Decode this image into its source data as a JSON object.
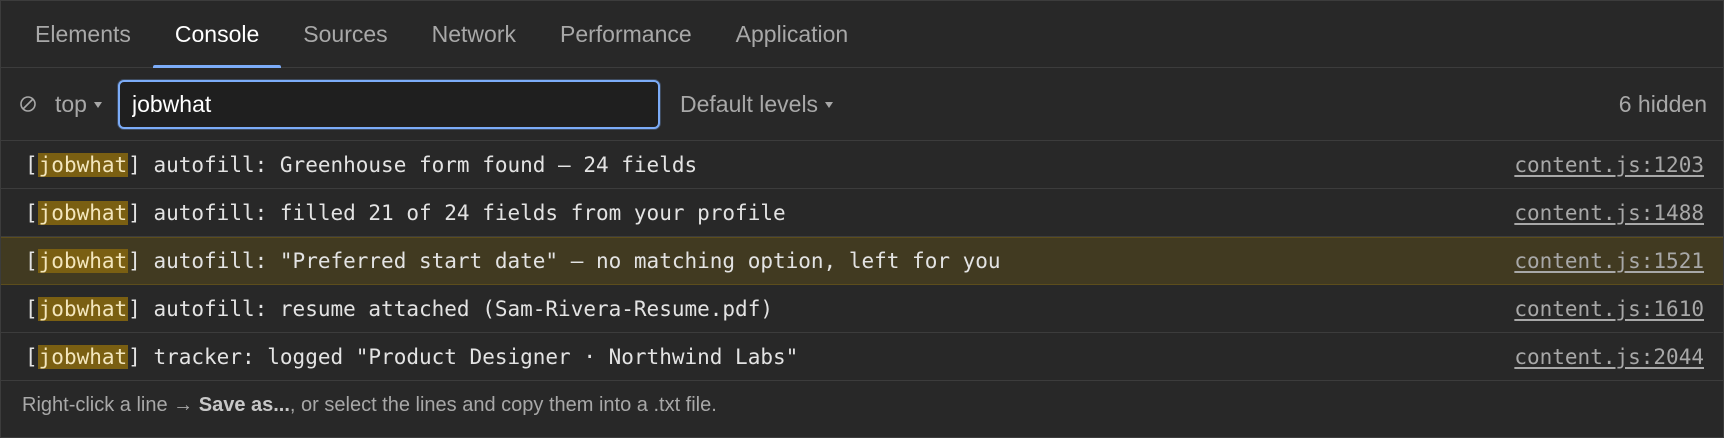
{
  "tabs": [
    {
      "label": "Elements",
      "active": false
    },
    {
      "label": "Console",
      "active": true
    },
    {
      "label": "Sources",
      "active": false
    },
    {
      "label": "Network",
      "active": false
    },
    {
      "label": "Performance",
      "active": false
    },
    {
      "label": "Application",
      "active": false
    }
  ],
  "toolbar": {
    "context_label": "top",
    "filter_value": "jobwhat",
    "levels_label": "Default levels",
    "hidden_count": "6 hidden"
  },
  "logs": [
    {
      "open": "[",
      "tag": "jobwhat",
      "close": "]",
      "text": " autofill: Greenhouse form found — 24 fields",
      "source": "content.js:1203",
      "level": "info"
    },
    {
      "open": "[",
      "tag": "jobwhat",
      "close": "]",
      "text": " autofill: filled 21 of 24 fields from your profile",
      "source": "content.js:1488",
      "level": "info"
    },
    {
      "open": "[",
      "tag": "jobwhat",
      "close": "]",
      "text": " autofill: \"Preferred start date\" — no matching option, left for you",
      "source": "content.js:1521",
      "level": "warn"
    },
    {
      "open": "[",
      "tag": "jobwhat",
      "close": "]",
      "text": " autofill: resume attached (Sam-Rivera-Resume.pdf)",
      "source": "content.js:1610",
      "level": "info"
    },
    {
      "open": "[",
      "tag": "jobwhat",
      "close": "]",
      "text": " tracker: logged \"Product Designer · Northwind Labs\"",
      "source": "content.js:2044",
      "level": "info"
    }
  ],
  "hint": {
    "prefix": "Right-click a line → ",
    "bold": "Save as...",
    "suffix": ", or select the lines and copy them into a .txt file."
  },
  "colors": {
    "accent": "#7cacf8",
    "warn_bg": "#413a21",
    "highlight": "#7a5f12"
  }
}
